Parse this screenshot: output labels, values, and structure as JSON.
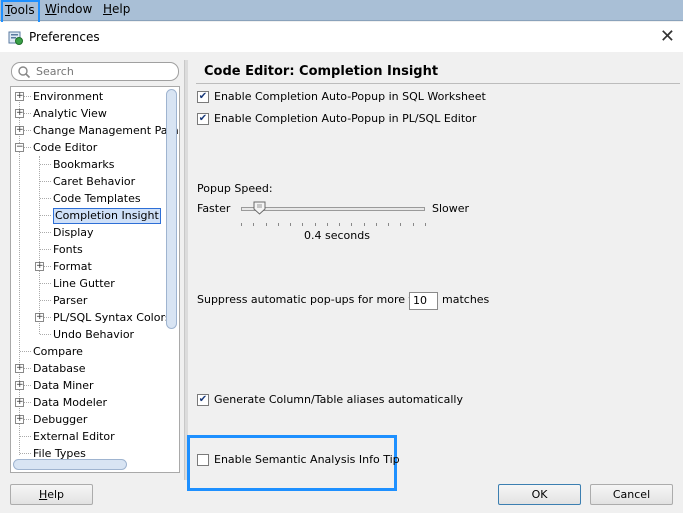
{
  "menubar": {
    "items": [
      {
        "label_u": "T",
        "label_rest": "ools"
      },
      {
        "label_u": "W",
        "label_rest": "indow"
      },
      {
        "label_u": "H",
        "label_rest": "elp"
      }
    ]
  },
  "window": {
    "title": "Preferences"
  },
  "search": {
    "placeholder": "Search"
  },
  "tree": [
    {
      "label": "Environment",
      "expandable": true
    },
    {
      "label": "Analytic View",
      "expandable": true
    },
    {
      "label": "Change Management Parar",
      "expandable": true
    },
    {
      "label": "Code Editor",
      "expandable": true,
      "expanded": true
    },
    {
      "label": "Bookmarks",
      "child": true
    },
    {
      "label": "Caret Behavior",
      "child": true
    },
    {
      "label": "Code Templates",
      "child": true
    },
    {
      "label": "Completion Insight",
      "child": true,
      "selected": true
    },
    {
      "label": "Display",
      "child": true
    },
    {
      "label": "Fonts",
      "child": true
    },
    {
      "label": "Format",
      "child": true,
      "expandable": true
    },
    {
      "label": "Line Gutter",
      "child": true
    },
    {
      "label": "Parser",
      "child": true
    },
    {
      "label": "PL/SQL Syntax Colors",
      "child": true,
      "expandable": true
    },
    {
      "label": "Undo Behavior",
      "child": true
    },
    {
      "label": "Compare"
    },
    {
      "label": "Database",
      "expandable": true
    },
    {
      "label": "Data Miner",
      "expandable": true
    },
    {
      "label": "Data Modeler",
      "expandable": true
    },
    {
      "label": "Debugger",
      "expandable": true
    },
    {
      "label": "External Editor"
    },
    {
      "label": "File Types"
    }
  ],
  "content": {
    "title": "Code Editor: Completion Insight",
    "auto_popup_sql": {
      "label": "Enable Completion Auto-Popup in SQL Worksheet",
      "checked": true
    },
    "auto_popup_plsql": {
      "label": "Enable Completion Auto-Popup in PL/SQL Editor",
      "checked": true
    },
    "popup_speed": {
      "label": "Popup Speed:",
      "min_label": "Faster",
      "max_label": "Slower",
      "value_text": "0.4 seconds",
      "level": 0.1
    },
    "suppress": {
      "label": "Suppress automatic pop-ups for more than",
      "value": "10",
      "unit": "matches"
    },
    "aliases": {
      "label": "Generate Column/Table aliases automatically",
      "checked": true
    },
    "semantic": {
      "label": "Enable Semantic Analysis Info Tip",
      "checked": false
    }
  },
  "buttons": {
    "help": {
      "label_u": "H",
      "label_rest": "elp"
    },
    "ok": "OK",
    "cancel": "Cancel"
  },
  "colors": {
    "highlight": "#1e90ff",
    "menubar": "#a9bfd6"
  }
}
